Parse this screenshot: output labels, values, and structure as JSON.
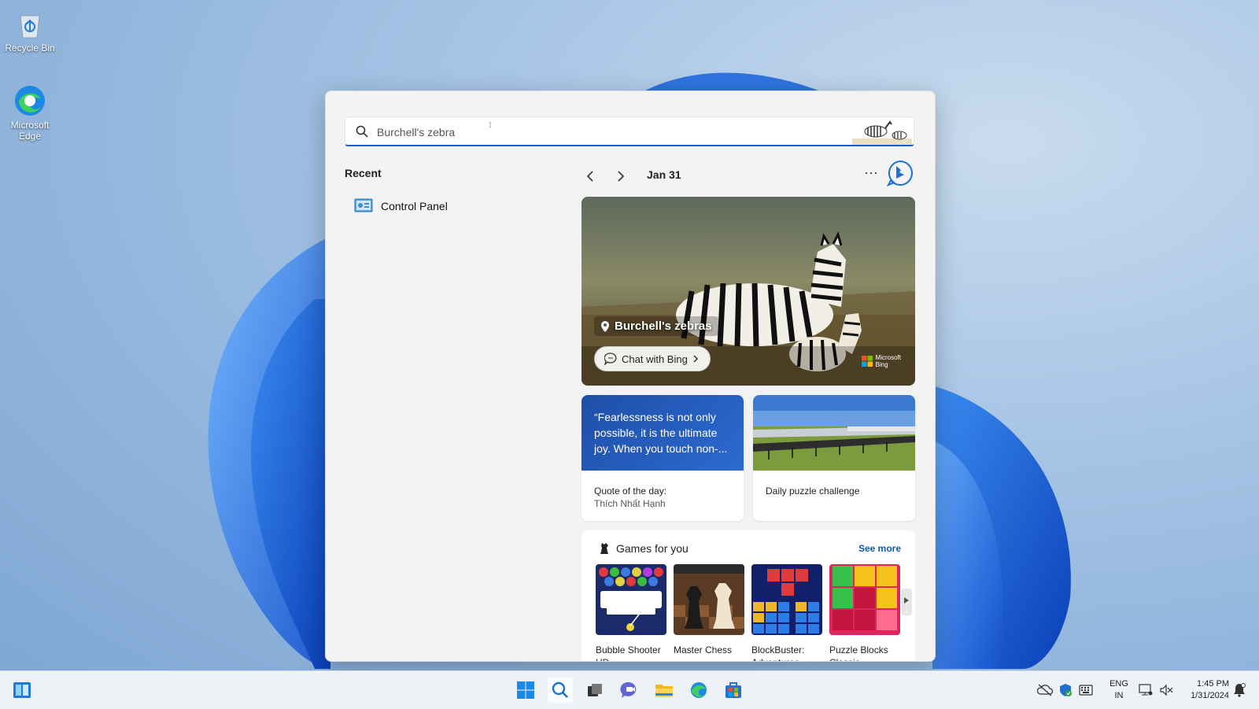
{
  "desktop": {
    "icons": [
      {
        "label": "Recycle Bin",
        "icon": "recycle-bin-icon"
      },
      {
        "label": "Microsoft Edge",
        "icon": "edge-icon"
      }
    ]
  },
  "search": {
    "value": "Burchell's zebra",
    "placeholder": "Burchell's zebra"
  },
  "recent": {
    "title": "Recent",
    "items": [
      {
        "label": "Control Panel",
        "icon": "control-panel-icon"
      }
    ]
  },
  "highlights": {
    "date": "Jan 31",
    "more_label": "···",
    "hero": {
      "title": "Burchell's zebras",
      "chat_label": "Chat with Bing",
      "badge_line1": "Microsoft",
      "badge_line2": "Bing"
    },
    "quote_card": {
      "text": "“Fearlessness is not only possible, it is the ultimate joy. When you touch non-...",
      "label": "Quote of the day:",
      "author": "Thích Nhất Hạnh"
    },
    "puzzle_card": {
      "label": "Daily puzzle challenge"
    },
    "games": {
      "title": "Games for you",
      "see_more": "See more",
      "items": [
        {
          "name": "Bubble Shooter HD"
        },
        {
          "name": "Master Chess"
        },
        {
          "name": "BlockBuster: Adventures ..."
        },
        {
          "name": "Puzzle Blocks Classic"
        }
      ]
    }
  },
  "taskbar": {
    "lang_line1": "ENG",
    "lang_line2": "IN",
    "time": "1:45 PM",
    "date": "1/31/2024"
  },
  "colors": {
    "accent": "#1f5fbf",
    "link": "#0b5cad",
    "quote_bg": "#1e4fa8"
  }
}
